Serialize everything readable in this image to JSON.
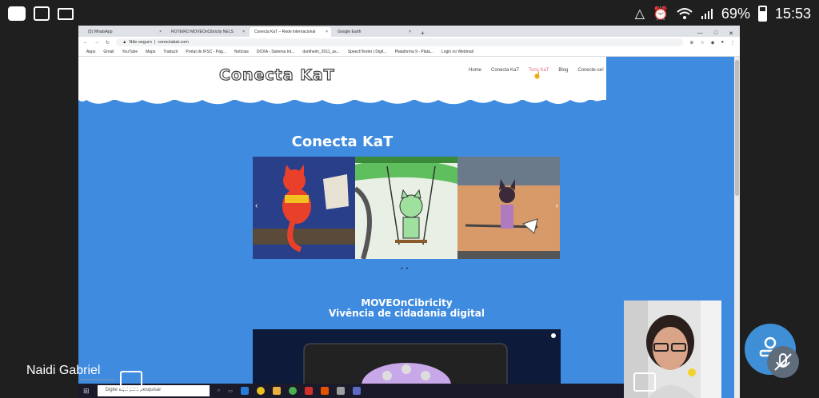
{
  "status_bar": {
    "battery": "69%",
    "time": "15:53",
    "left_icons": [
      "teams-icon",
      "gallery-icon",
      "screen-icon",
      "more-dots-icon"
    ],
    "right_icons": [
      "alarm-icon",
      "wifi-icon",
      "signal-icon",
      "battery-icon"
    ]
  },
  "browser": {
    "tabs": [
      {
        "label": "(5) WhatsApp"
      },
      {
        "label": "ROTEIRO MOVEOnCibricity NELS"
      },
      {
        "label": "Conecta KaT – Rede internacional"
      },
      {
        "label": "Google Earth"
      }
    ],
    "new_tab": "+",
    "address": {
      "secure_label": "Não seguro",
      "url": "conectakat.com"
    },
    "bookmarks": [
      "Apps",
      "Gmail",
      "YouTube",
      "Maps",
      "Traduzir",
      "Portal do IFSC - Pág...",
      "Notícias",
      "DOXA - Sistema Int...",
      "durkheim_2011_as...",
      "SpeechTexter | Digit...",
      "Plataforma 9 - Plata...",
      "Login no Webmail"
    ]
  },
  "site": {
    "logo": "Conecta KaT",
    "nav": [
      "Home",
      "Conecta KaT",
      "Tons KaT",
      "Blog",
      "Conecte-se!"
    ],
    "title": "Conecta KaT",
    "subtitle_1": "MOVEOnCibricity",
    "subtitle_2": "Vivência de cidadania digital",
    "carousel_prev": "‹",
    "carousel_next": "›"
  },
  "taskbar": {
    "search_placeholder": "Digite aqui para pesquisar",
    "tooltip": "conectakat.com/tons-kat"
  },
  "meeting": {
    "participant_name": "Naidi Gabriel"
  },
  "colors": {
    "page_blue": "#3f8be0",
    "nav_active": "#e26a8c",
    "fab": "#3f8fd6"
  }
}
